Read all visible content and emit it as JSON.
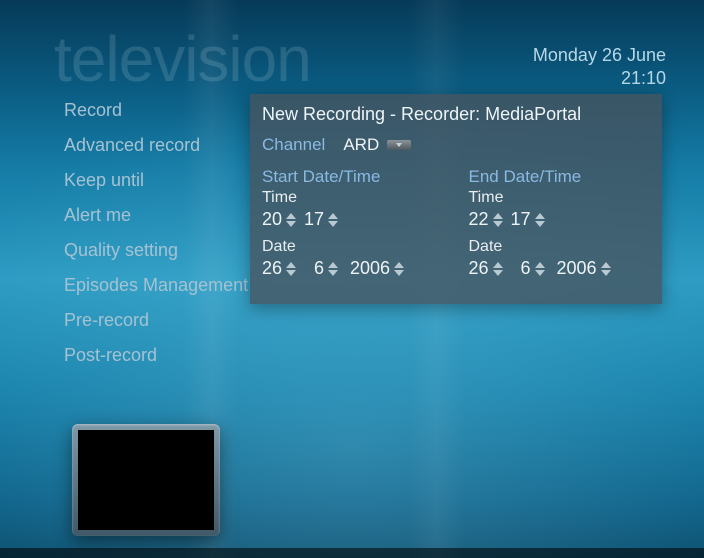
{
  "watermark": "television",
  "clock": {
    "date": "Monday 26 June",
    "time": "21:10"
  },
  "sidebar": {
    "items": [
      {
        "label": "Record"
      },
      {
        "label": "Advanced record"
      },
      {
        "label": "Keep until"
      },
      {
        "label": "Alert me"
      },
      {
        "label": "Quality setting"
      },
      {
        "label": "Episodes Management"
      },
      {
        "label": "Pre-record"
      },
      {
        "label": "Post-record"
      }
    ]
  },
  "panel": {
    "title": "New Recording - Recorder: MediaPortal",
    "channel_label": "Channel",
    "channel_value": "ARD",
    "start": {
      "heading": "Start Date/Time",
      "time_label": "Time",
      "time_h": "20",
      "time_m": "17",
      "date_label": "Date",
      "date_d": "26",
      "date_m": "6",
      "date_y": "2006"
    },
    "end": {
      "heading": "End Date/Time",
      "time_label": "Time",
      "time_h": "22",
      "time_m": "17",
      "date_label": "Date",
      "date_d": "26",
      "date_m": "6",
      "date_y": "2006"
    }
  }
}
